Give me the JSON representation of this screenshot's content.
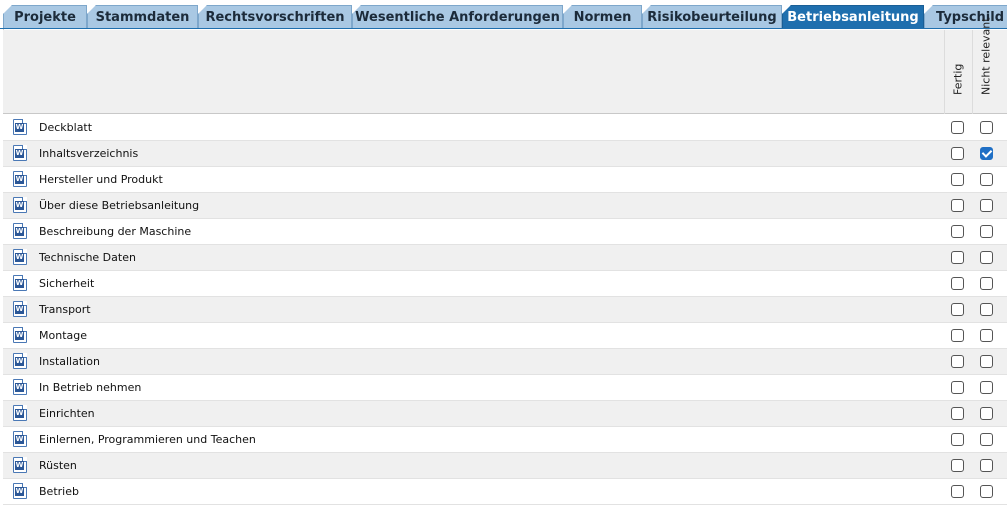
{
  "tabs": [
    {
      "label": "Projekte",
      "active": false
    },
    {
      "label": "Stammdaten",
      "active": false
    },
    {
      "label": "Rechtsvorschriften",
      "active": false
    },
    {
      "label": "Wesentliche Anforderungen",
      "active": false
    },
    {
      "label": "Normen",
      "active": false
    },
    {
      "label": "Risikobeurteilung",
      "active": false
    },
    {
      "label": "Betriebsanleitung",
      "active": true
    },
    {
      "label": "Typschild",
      "active": false
    }
  ],
  "columns": {
    "fertig": "Fertig",
    "nicht_relevant": "Nicht relevant"
  },
  "rows": [
    {
      "label": "Deckblatt",
      "fertig": false,
      "nicht_relevant": false
    },
    {
      "label": "Inhaltsverzeichnis",
      "fertig": false,
      "nicht_relevant": true
    },
    {
      "label": "Hersteller und Produkt",
      "fertig": false,
      "nicht_relevant": false
    },
    {
      "label": "Über diese Betriebsanleitung",
      "fertig": false,
      "nicht_relevant": false
    },
    {
      "label": "Beschreibung der Maschine",
      "fertig": false,
      "nicht_relevant": false
    },
    {
      "label": "Technische Daten",
      "fertig": false,
      "nicht_relevant": false
    },
    {
      "label": "Sicherheit",
      "fertig": false,
      "nicht_relevant": false
    },
    {
      "label": "Transport",
      "fertig": false,
      "nicht_relevant": false
    },
    {
      "label": "Montage",
      "fertig": false,
      "nicht_relevant": false
    },
    {
      "label": "Installation",
      "fertig": false,
      "nicht_relevant": false
    },
    {
      "label": "In Betrieb nehmen",
      "fertig": false,
      "nicht_relevant": false
    },
    {
      "label": "Einrichten",
      "fertig": false,
      "nicht_relevant": false
    },
    {
      "label": "Einlernen, Programmieren und Teachen",
      "fertig": false,
      "nicht_relevant": false
    },
    {
      "label": "Rüsten",
      "fertig": false,
      "nicht_relevant": false
    },
    {
      "label": "Betrieb",
      "fertig": false,
      "nicht_relevant": false
    }
  ],
  "colors": {
    "tab_inactive": "#a9c8e3",
    "tab_active": "#1f6fae",
    "checkbox_checked": "#1f6fc5",
    "row_alt": "#f0f0f0"
  },
  "icons": {
    "row_icon": "word-document-icon"
  }
}
